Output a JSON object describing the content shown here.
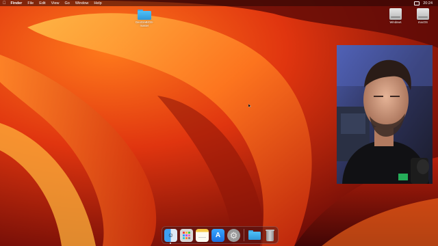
{
  "menubar": {
    "apple": "",
    "items": [
      "Finder",
      "File",
      "Edit",
      "View",
      "Go",
      "Window",
      "Help"
    ],
    "clock": "20:24"
  },
  "desktop": {
    "folder_label": "OpenCore-master",
    "folder_label_line1": "GeoGraBIOS-",
    "folder_label_line2": "master",
    "drives": [
      {
        "label": "Windows",
        "icon": "hard-drive-icon"
      },
      {
        "label": "macOS",
        "icon": "hard-drive-icon"
      }
    ]
  },
  "dock": {
    "apps": [
      {
        "name": "Finder",
        "icon": "finder-icon"
      },
      {
        "name": "Launchpad",
        "icon": "launchpad-icon"
      },
      {
        "name": "Notes",
        "icon": "notes-icon"
      },
      {
        "name": "App Store",
        "icon": "app-store-icon"
      },
      {
        "name": "System Preferences",
        "icon": "settings-icon"
      },
      {
        "name": "Downloads",
        "icon": "folder-icon"
      },
      {
        "name": "Trash",
        "icon": "trash-icon"
      }
    ]
  },
  "colors": {
    "wallpaper_dark": "#5e0a06",
    "wallpaper_orange": "#f26a1b",
    "wallpaper_yellow": "#ffb13b",
    "folder_blue": "#3aa7e6"
  }
}
